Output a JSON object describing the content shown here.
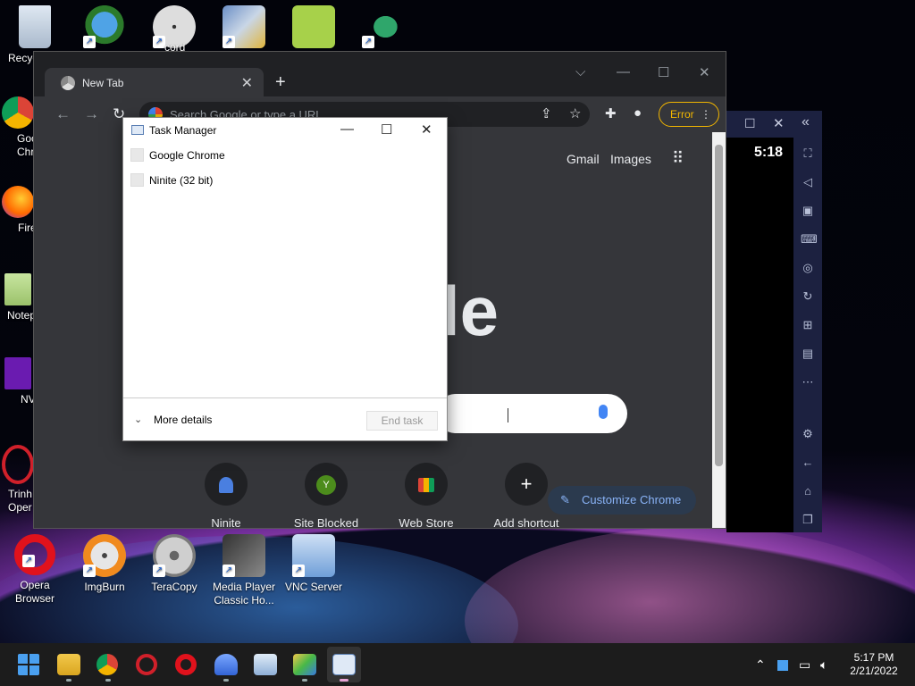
{
  "desktop": {
    "icons": [
      {
        "label": "Recyc",
        "name": "recycle-bin-icon"
      },
      {
        "label": "Goo Chr",
        "name": "google-chrome-icon"
      },
      {
        "label": "Fire",
        "name": "firefox-icon"
      },
      {
        "label": "Notep",
        "name": "notepad-icon"
      },
      {
        "label": "NV",
        "name": "nv-icon"
      },
      {
        "label": "Trinh Oper",
        "name": "trinh-oper-icon"
      },
      {
        "label": "Opera Browser",
        "name": "opera-browser-icon"
      },
      {
        "label": "ImgBurn",
        "name": "imgburn-icon"
      },
      {
        "label": "TeraCopy",
        "name": "teracopy-icon"
      },
      {
        "label": "Media Player Classic Ho...",
        "name": "media-player-classic-icon"
      },
      {
        "label": "VNC Server",
        "name": "vnc-server-icon"
      }
    ],
    "partial_text": "cord"
  },
  "chrome": {
    "tab_title": "New Tab",
    "tab_close": "✕",
    "new_tab": "+",
    "omnibox_placeholder": "Search Google or type a URL",
    "error_label": "Error",
    "menu_dots": "⋮",
    "gmail": "Gmail",
    "images": "Images",
    "logo_fragment": "le",
    "shortcuts": [
      {
        "label": "Ninite",
        "badge": ""
      },
      {
        "label": "Site Blocked",
        "badge": "Y"
      },
      {
        "label": "Web Store",
        "badge": ""
      },
      {
        "label": "Add shortcut",
        "badge": "+"
      }
    ],
    "customize": "Customize Chrome",
    "colors": {
      "accent": "#8ab4f8",
      "error": "#f2b600",
      "bg": "#35363a"
    }
  },
  "bluestacks": {
    "clock": "5:18"
  },
  "task_manager": {
    "title": "Task Manager",
    "apps": [
      "Google Chrome",
      "Ninite (32 bit)"
    ],
    "more_details": "More details",
    "end_task": "End task"
  },
  "taskbar": {
    "time": "5:17 PM",
    "date": "2/21/2022"
  }
}
